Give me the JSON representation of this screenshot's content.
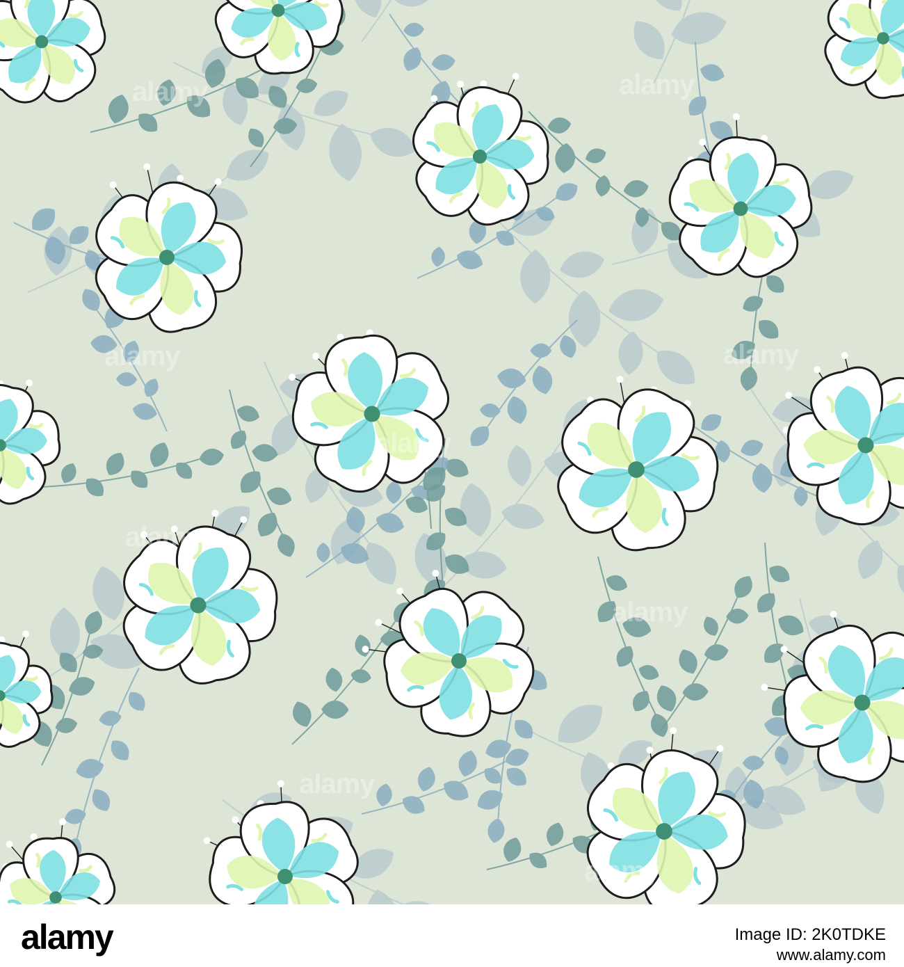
{
  "colors": {
    "background": "#dde5d6",
    "leaf_dark": "#6f9c9a",
    "leaf_blue": "#8aaec0",
    "leaf_shadow": "#b5c8ce",
    "petal_white": "#ffffff",
    "petal_green": "#dff5b0",
    "petal_aqua": "#7fe0e2",
    "flower_center": "#3f8f72",
    "outline": "#1d1d1d"
  },
  "watermark": {
    "text": "alamy"
  },
  "footer": {
    "logo": "alamy",
    "image_id": "Image ID: 2K0TDKE",
    "url": "www.alamy.com"
  }
}
